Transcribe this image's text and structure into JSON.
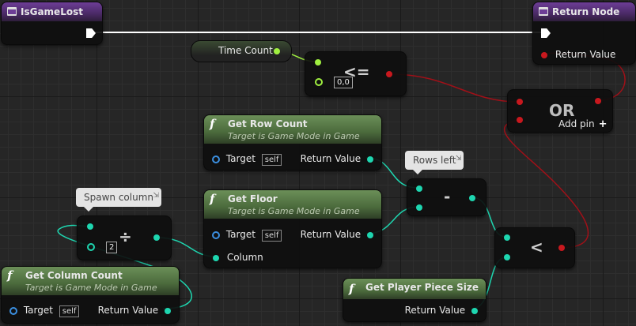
{
  "nodes": {
    "is_game_lost": {
      "title": "IsGameLost"
    },
    "return_node": {
      "title": "Return Node",
      "return_value_label": "Return Value"
    },
    "time_count": {
      "label": "Time Count"
    },
    "less_equal": {
      "symbol": "<=",
      "input_value": "0,0"
    },
    "or_node": {
      "title": "OR",
      "add_pin_label": "Add pin"
    },
    "get_row_count": {
      "title": "Get Row Count",
      "subtitle": "Target is Game Mode in Game",
      "target_label": "Target",
      "target_value": "self",
      "return_label": "Return Value"
    },
    "rows_left_comment": {
      "text": "Rows left"
    },
    "subtract": {
      "symbol": "-"
    },
    "spawn_column_comment": {
      "text": "Spawn column"
    },
    "divide": {
      "symbol": "÷",
      "input_value": "2"
    },
    "get_floor": {
      "title": "Get Floor",
      "subtitle": "Target is Game Mode in Game",
      "target_label": "Target",
      "target_value": "self",
      "return_label": "Return Value",
      "column_label": "Column"
    },
    "less_than": {
      "symbol": "<"
    },
    "get_column_count": {
      "title": "Get Column Count",
      "subtitle": "Target is Game Mode in Game",
      "target_label": "Target",
      "target_value": "self",
      "return_label": "Return Value"
    },
    "get_player_piece_size": {
      "title": "Get Player Piece Size",
      "return_label": "Return Value"
    }
  },
  "colors": {
    "exec_wire": "#ffffff",
    "float_wire": "#a0f040",
    "int_wire": "#1ed6b0",
    "bool_wire": "#a01018",
    "function_header": "#4b6a3c",
    "entry_header": "#4a2a66"
  }
}
